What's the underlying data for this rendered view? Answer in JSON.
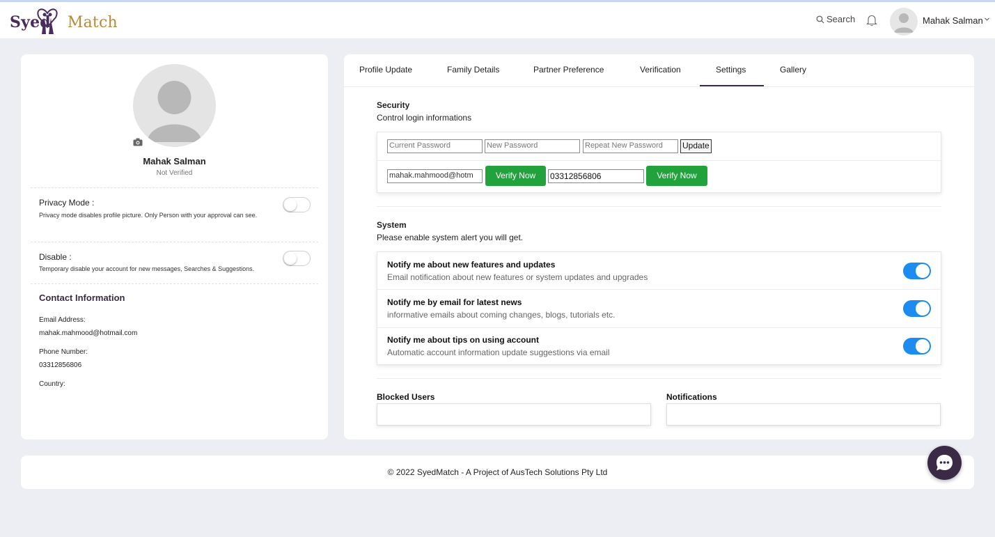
{
  "brand": {
    "name_prefix": "Syed",
    "name_suffix": "Match"
  },
  "header": {
    "search_label": "Search",
    "user_name": "Mahak Salman"
  },
  "profile": {
    "name": "Mahak Salman",
    "status": "Not Verified",
    "privacy": {
      "title": "Privacy Mode :",
      "desc": "Privacy mode disables profile picture. Only Person with your approval can see."
    },
    "disable": {
      "title": "Disable :",
      "desc": "Temporary disable your account for new messages, Searches & Suggestions."
    },
    "contact": {
      "title": "Contact Information",
      "email_label": "Email Address:",
      "email_value": "mahak.mahmood@hotmail.com",
      "phone_label": "Phone Number:",
      "phone_value": "03312856806",
      "country_label": "Country:"
    }
  },
  "tabs": [
    "Profile Update",
    "Family Details",
    "Partner Preference",
    "Verification",
    "Settings",
    "Gallery"
  ],
  "active_tab": "Settings",
  "security": {
    "title": "Security",
    "subtitle": "Control login informations",
    "current_password_placeholder": "Current Password",
    "new_password_placeholder": "New Password",
    "repeat_password_placeholder": "Repeat New Password",
    "update_label": "Update",
    "email_value": "mahak.mahmood@hotm",
    "verify_label": "Verify Now",
    "phone_value": "03312856806"
  },
  "system": {
    "title": "System",
    "subtitle": "Please enable system alert you will get.",
    "notifications": [
      {
        "title": "Notify me about new features and updates",
        "desc": "Email notification about new features or system updates and upgrades",
        "enabled": true
      },
      {
        "title": "Notify me by email for latest news",
        "desc": "informative emails about coming changes, blogs, tutorials etc.",
        "enabled": true
      },
      {
        "title": "Notify me about tips on using account",
        "desc": "Automatic account information update suggestions via email",
        "enabled": true
      }
    ]
  },
  "blocked_users": {
    "title": "Blocked Users"
  },
  "notifications_box": {
    "title": "Notifications"
  },
  "footer": {
    "copyright": "© 2022 SyedMatch - A Project of AusTech Solutions Pty Ltd"
  },
  "colors": {
    "brand_gold": "#b58a3b",
    "brand_purple": "#3a2a45",
    "verify_green": "#22a23d",
    "toggle_blue": "#1d8cf0",
    "page_bg": "#eceef3"
  }
}
